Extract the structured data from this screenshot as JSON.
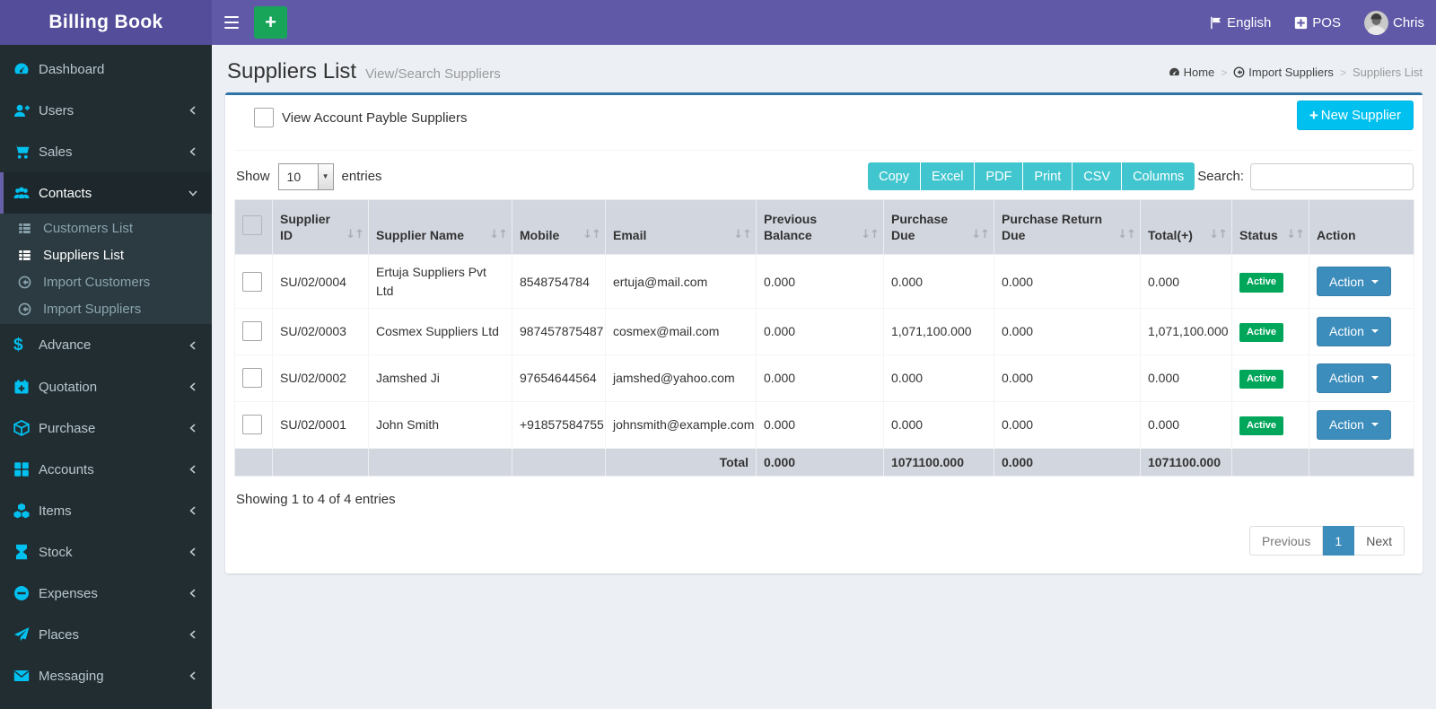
{
  "app": {
    "title": "Billing Book"
  },
  "header": {
    "language": "English",
    "pos_label": "POS",
    "user_name": "Chris"
  },
  "sidebar": {
    "items": [
      {
        "label": "Dashboard",
        "icon": "dashboard"
      },
      {
        "label": "Users",
        "icon": "users",
        "chevron": "left"
      },
      {
        "label": "Sales",
        "icon": "cart",
        "chevron": "left"
      },
      {
        "label": "Contacts",
        "icon": "contacts",
        "chevron": "down",
        "active": true,
        "children": [
          {
            "label": "Customers List",
            "icon": "list"
          },
          {
            "label": "Suppliers List",
            "icon": "list",
            "active": true
          },
          {
            "label": "Import Customers",
            "icon": "import"
          },
          {
            "label": "Import Suppliers",
            "icon": "import"
          }
        ]
      },
      {
        "label": "Advance",
        "icon": "dollar",
        "chevron": "left"
      },
      {
        "label": "Quotation",
        "icon": "calendar-plus",
        "chevron": "left"
      },
      {
        "label": "Purchase",
        "icon": "cube",
        "chevron": "left"
      },
      {
        "label": "Accounts",
        "icon": "grid",
        "chevron": "left"
      },
      {
        "label": "Items",
        "icon": "cubes",
        "chevron": "left"
      },
      {
        "label": "Stock",
        "icon": "hourglass",
        "chevron": "left"
      },
      {
        "label": "Expenses",
        "icon": "minus-circle",
        "chevron": "left"
      },
      {
        "label": "Places",
        "icon": "paper-plane",
        "chevron": "left"
      },
      {
        "label": "Messaging",
        "icon": "envelope",
        "chevron": "left"
      }
    ]
  },
  "page": {
    "title": "Suppliers List",
    "subtitle": "View/Search Suppliers"
  },
  "breadcrumb": [
    {
      "label": "Home",
      "icon": "dashboard"
    },
    {
      "label": "Import Suppliers",
      "icon": "import"
    },
    {
      "label": "Suppliers List"
    }
  ],
  "filters": {
    "checkbox_label": "View Account Payble Suppliers"
  },
  "actions": {
    "new_supplier": "New Supplier"
  },
  "controls": {
    "show_label": "Show",
    "page_size": "10",
    "entries_label": "entries",
    "export_buttons": [
      "Copy",
      "Excel",
      "PDF",
      "Print",
      "CSV",
      "Columns"
    ],
    "search_label": "Search:"
  },
  "table": {
    "columns": [
      {
        "label": "",
        "sortable": false
      },
      {
        "label": "Supplier ID",
        "sortable": true
      },
      {
        "label": "Supplier Name",
        "sortable": true
      },
      {
        "label": "Mobile",
        "sortable": true
      },
      {
        "label": "Email",
        "sortable": true
      },
      {
        "label": "Previous Balance",
        "sortable": true
      },
      {
        "label": "Purchase Due",
        "sortable": true
      },
      {
        "label": "Purchase Return Due",
        "sortable": true
      },
      {
        "label": "Total(+)",
        "sortable": true
      },
      {
        "label": "Status",
        "sortable": true
      },
      {
        "label": "Action",
        "sortable": false
      }
    ],
    "rows": [
      {
        "id": "SU/02/0004",
        "name": "Ertuja Suppliers Pvt Ltd",
        "mobile": "8548754784",
        "email": "ertuja@mail.com",
        "previous_balance": "0.000",
        "purchase_due": "0.000",
        "purchase_return_due": "0.000",
        "total": "0.000",
        "status": "Active",
        "action": "Action"
      },
      {
        "id": "SU/02/0003",
        "name": "Cosmex Suppliers Ltd",
        "mobile": "987457875487",
        "email": "cosmex@mail.com",
        "previous_balance": "0.000",
        "purchase_due": "1,071,100.000",
        "purchase_return_due": "0.000",
        "total": "1,071,100.000",
        "status": "Active",
        "action": "Action"
      },
      {
        "id": "SU/02/0002",
        "name": "Jamshed Ji",
        "mobile": "97654644564",
        "email": "jamshed@yahoo.com",
        "previous_balance": "0.000",
        "purchase_due": "0.000",
        "purchase_return_due": "0.000",
        "total": "0.000",
        "status": "Active",
        "action": "Action"
      },
      {
        "id": "SU/02/0001",
        "name": "John Smith",
        "mobile": "+91857584755",
        "email": "johnsmith@example.com",
        "previous_balance": "0.000",
        "purchase_due": "0.000",
        "purchase_return_due": "0.000",
        "total": "0.000",
        "status": "Active",
        "action": "Action"
      }
    ],
    "footer": {
      "label": "Total",
      "previous_balance": "0.000",
      "purchase_due": "1071100.000",
      "purchase_return_due": "0.000",
      "total": "1071100.000"
    }
  },
  "summary": {
    "info": "Showing 1 to 4 of 4 entries"
  },
  "pagination": {
    "previous": "Previous",
    "current": "1",
    "next": "Next"
  },
  "colors": {
    "navbar": "#6059a8",
    "logo_bg": "#544d99",
    "sidebar_bg": "#222d32",
    "sidebar_icon": "#00c0ef",
    "box_border": "#2e74a8",
    "new_supplier_btn": "#00c0ef",
    "export_btn": "#41c6cf",
    "action_btn": "#3c8dbc",
    "status_active": "#00a65a",
    "header_add_btn": "#18a55a",
    "table_head_bg": "#d2d6de"
  }
}
